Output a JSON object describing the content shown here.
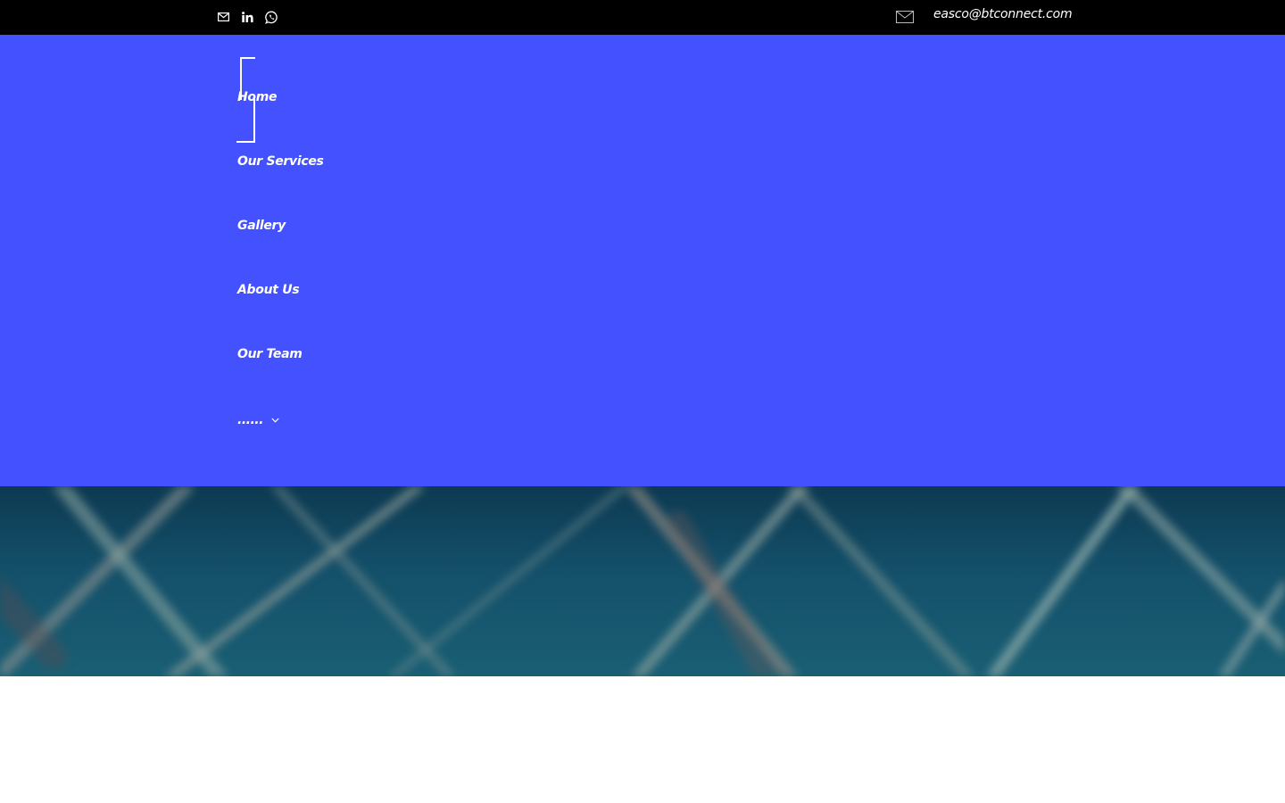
{
  "top_bar": {
    "social_icons": [
      "mail-icon",
      "linkedin-icon",
      "whatsapp-icon"
    ],
    "contact_icon": "envelope-icon",
    "contact_email": "easco@btconnect.com"
  },
  "nav": {
    "items": [
      {
        "label": "Home"
      },
      {
        "label": "Our Services"
      },
      {
        "label": "Gallery"
      },
      {
        "label": "About Us"
      },
      {
        "label": "Our Team"
      }
    ],
    "more": {
      "label": "......",
      "icon": "chevron-down-icon"
    }
  },
  "colors": {
    "top_bar_bg": "#000000",
    "nav_bg": "#4351fe",
    "text": "#ffffff",
    "page_bg": "#ffffff"
  }
}
